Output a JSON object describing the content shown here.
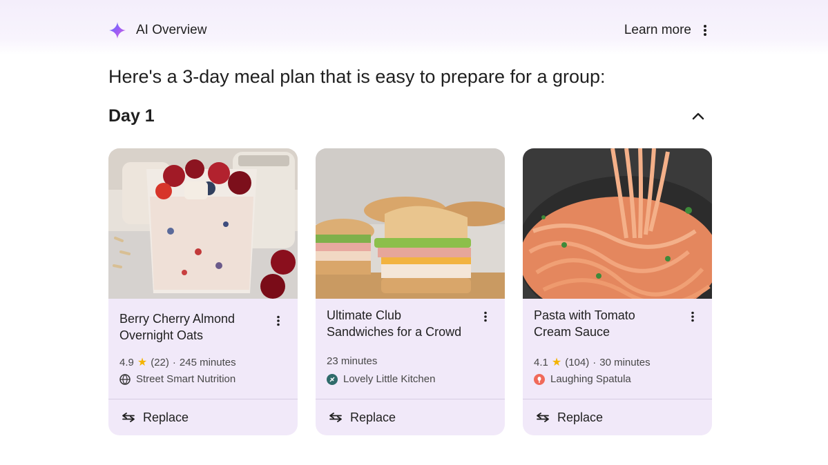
{
  "header": {
    "title": "AI Overview",
    "learn_more": "Learn more",
    "sparkle_icon": "gemini-sparkle-icon",
    "more_icon": "more-vert-icon"
  },
  "intro": "Here's a 3-day meal plan that is easy to prepare for a group:",
  "day": {
    "title": "Day 1",
    "toggle_icon": "chevron-up-icon"
  },
  "colors": {
    "card_bg": "#f1e9f9",
    "band": "#f4eefb",
    "star": "#f4b400",
    "accent": "#8b5cf6"
  },
  "cards": [
    {
      "name": "Berry Cherry Almond Overnight Oats",
      "rating": "4.9",
      "reviews": "(22)",
      "time": "245 minutes",
      "source": "Street Smart Nutrition",
      "source_icon": "globe-icon",
      "replace": "Replace",
      "image": "overnight-oats-photo"
    },
    {
      "name": "Ultimate Club Sandwiches for a Crowd",
      "time": "23 minutes",
      "source": "Lovely Little Kitchen",
      "source_icon": "site-logo-icon",
      "replace": "Replace",
      "image": "club-sandwich-photo"
    },
    {
      "name": "Pasta with Tomato Cream Sauce",
      "rating": "4.1",
      "reviews": "(104)",
      "time": "30 minutes",
      "source": "Laughing Spatula",
      "source_icon": "site-logo-icon",
      "replace": "Replace",
      "image": "pasta-photo"
    }
  ]
}
